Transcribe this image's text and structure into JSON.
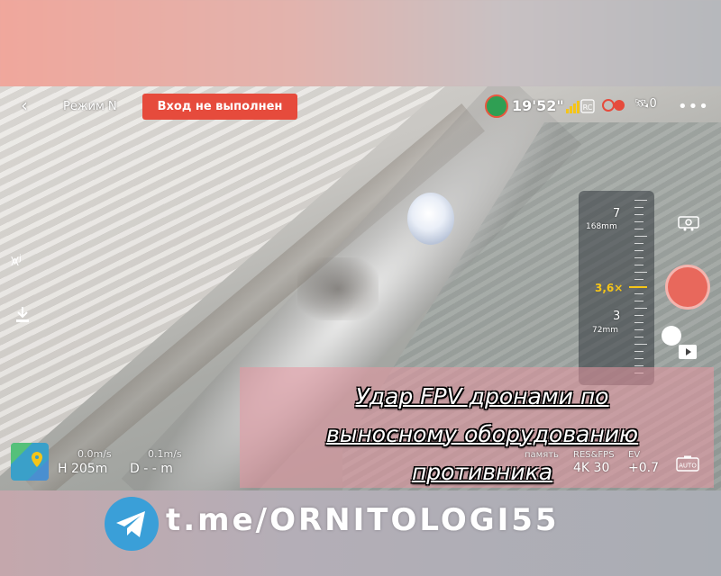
{
  "hud": {
    "mode_label": "Режим N",
    "warning_text": "Вход не выполнен",
    "flight_time": "19'52\"",
    "gps_count": "0"
  },
  "zoom": {
    "top_value": "7",
    "top_mm": "168mm",
    "current_value": "3,6×",
    "bottom_value": "3",
    "bottom_mm": "72mm"
  },
  "caption": {
    "line1": "Удар FPV дронами по",
    "line2": "выносному оборудованию",
    "line3": "противника"
  },
  "telemetry": {
    "vertical_speed": "0.0m/s",
    "horizontal_speed": "0.1m/s",
    "height": "H 205m",
    "distance": "D - - m"
  },
  "camera_settings": {
    "storage_label": "память",
    "res_label": "RES&FPS",
    "ev_label": "EV",
    "res_value": "4K 30",
    "ev_value": "+0.7",
    "auto_label": "AUTO"
  },
  "footer": {
    "channel_link": "t.me/ORNITOLOGI55"
  },
  "colors": {
    "warning": "#e64b3c",
    "shutter": "#e8685c",
    "zoom_accent": "#f5c518",
    "telegram": "#3a9fd8"
  }
}
